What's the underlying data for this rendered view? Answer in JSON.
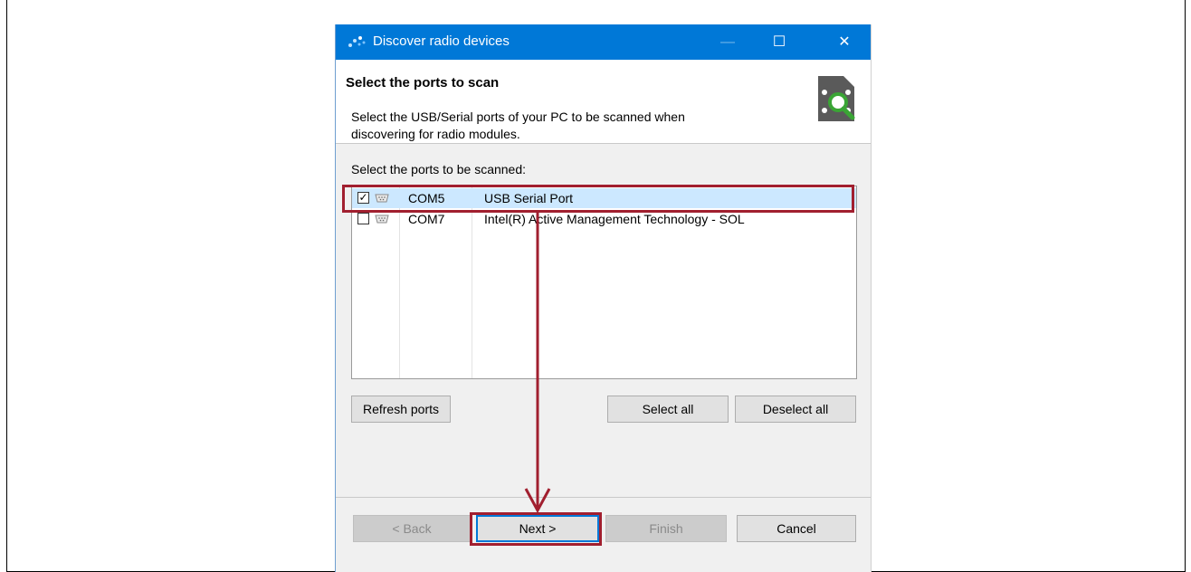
{
  "window": {
    "title": "Discover radio devices",
    "minimize_glyph": "—",
    "maximize_glyph": "☐",
    "close_glyph": "✕"
  },
  "header": {
    "title": "Select the ports to scan",
    "description": "Select the USB/Serial ports of your PC to be scanned when discovering for radio modules.",
    "icon": "device-search-icon"
  },
  "ports": {
    "label": "Select the ports to be scanned:",
    "rows": [
      {
        "checked": true,
        "port": "COM5",
        "description": "USB Serial Port",
        "selected": true
      },
      {
        "checked": false,
        "port": "COM7",
        "description": "Intel(R) Active Management Technology - SOL",
        "selected": false
      }
    ]
  },
  "actions": {
    "refresh": "Refresh ports",
    "select_all": "Select all",
    "deselect_all": "Deselect all"
  },
  "footer": {
    "back": "< Back",
    "next": "Next >",
    "finish": "Finish",
    "cancel": "Cancel"
  },
  "colors": {
    "titlebar": "#0078d7",
    "highlight": "#a11f2f",
    "selection": "#cce8ff"
  }
}
